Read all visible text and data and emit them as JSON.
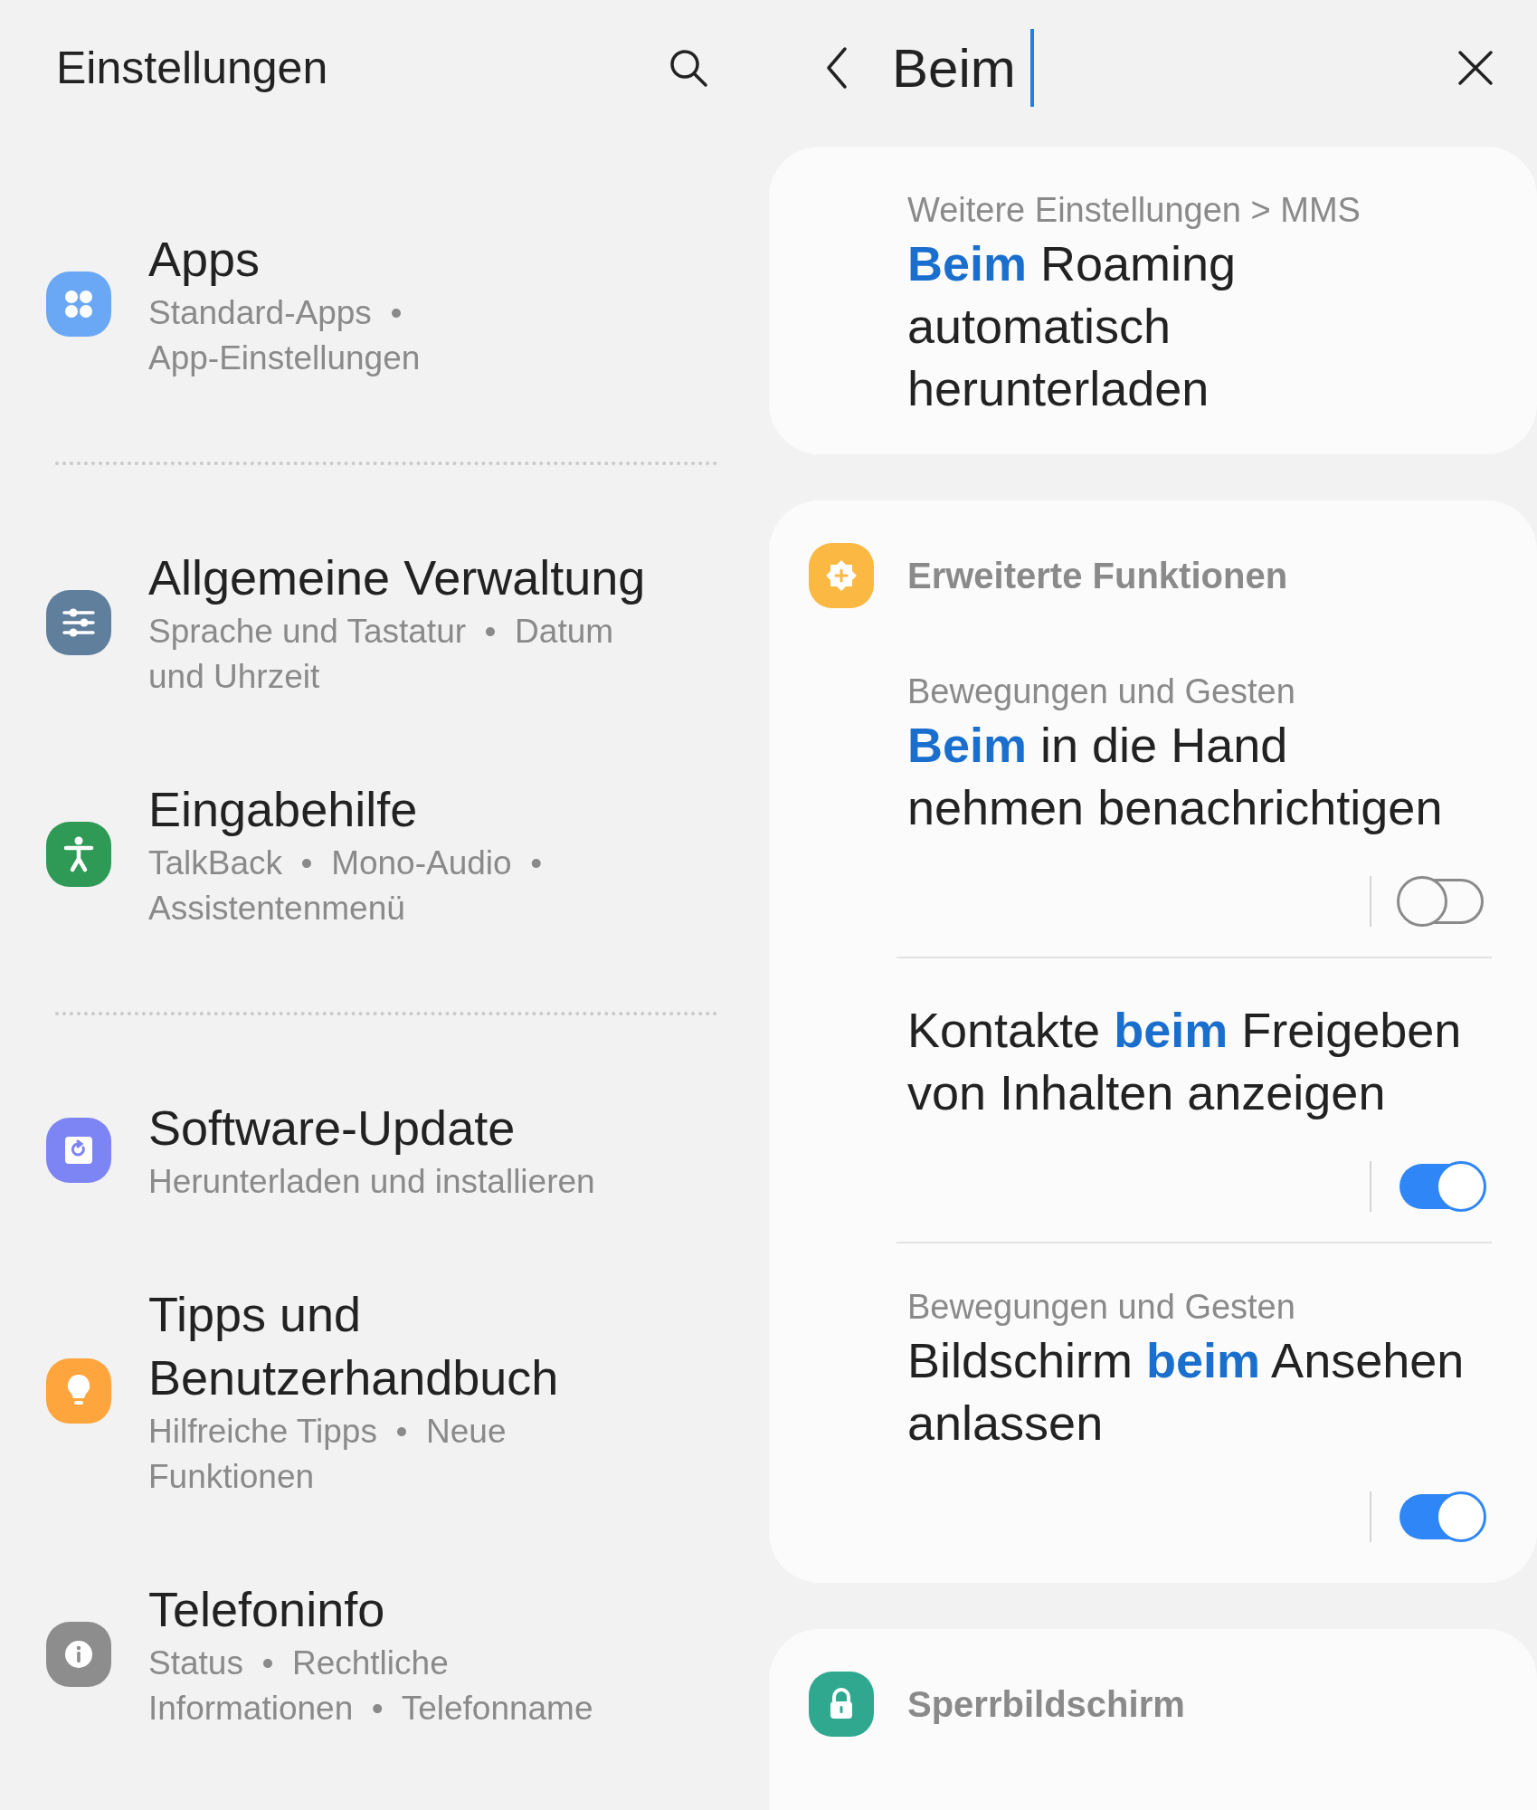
{
  "settings": {
    "title": "Einstellungen",
    "groups": [
      {
        "items": [
          {
            "kind": "apps",
            "title": "Apps",
            "subtitle": "Standard-Apps  •\nApp-Einstellungen"
          }
        ]
      },
      {
        "items": [
          {
            "kind": "general",
            "title": "Allgemeine Verwaltung",
            "subtitle": "Sprache und Tastatur  •  Datum\nund Uhrzeit"
          },
          {
            "kind": "accessibility",
            "title": "Eingabehilfe",
            "subtitle": "TalkBack  •  Mono-Audio  •\nAssistentenmenü"
          }
        ]
      },
      {
        "items": [
          {
            "kind": "update",
            "title": "Software-Update",
            "subtitle": "Herunterladen und installieren"
          },
          {
            "kind": "tips",
            "title": "Tipps und\nBenutzerhandbuch",
            "subtitle": "Hilfreiche Tipps  •  Neue\nFunktionen"
          },
          {
            "kind": "info",
            "title": "Telefoninfo",
            "subtitle": "Status  •  Rechtliche\nInformationen  •  Telefonname"
          }
        ]
      }
    ]
  },
  "search": {
    "value": "Beim"
  },
  "results": [
    {
      "items": [
        {
          "path": "Weitere Einstellungen > MMS",
          "title": "**Beim** Roaming\nautomatisch\nherunterladen"
        }
      ]
    },
    {
      "category": {
        "kind": "advanced",
        "label": "Erweiterte Funktionen"
      },
      "items": [
        {
          "path": "Bewegungen und Gesten",
          "title": "**Beim** in die Hand\nnehmen benachrichtigen",
          "on": false
        },
        {
          "title": "Kontakte **beim** Freigeben\nvon Inhalten anzeigen",
          "on": true
        },
        {
          "path": "Bewegungen und Gesten",
          "title": "Bildschirm **beim** Ansehen\nanlassen",
          "on": true
        }
      ]
    },
    {
      "category": {
        "kind": "lock",
        "label": "Sperrbildschirm"
      }
    }
  ]
}
